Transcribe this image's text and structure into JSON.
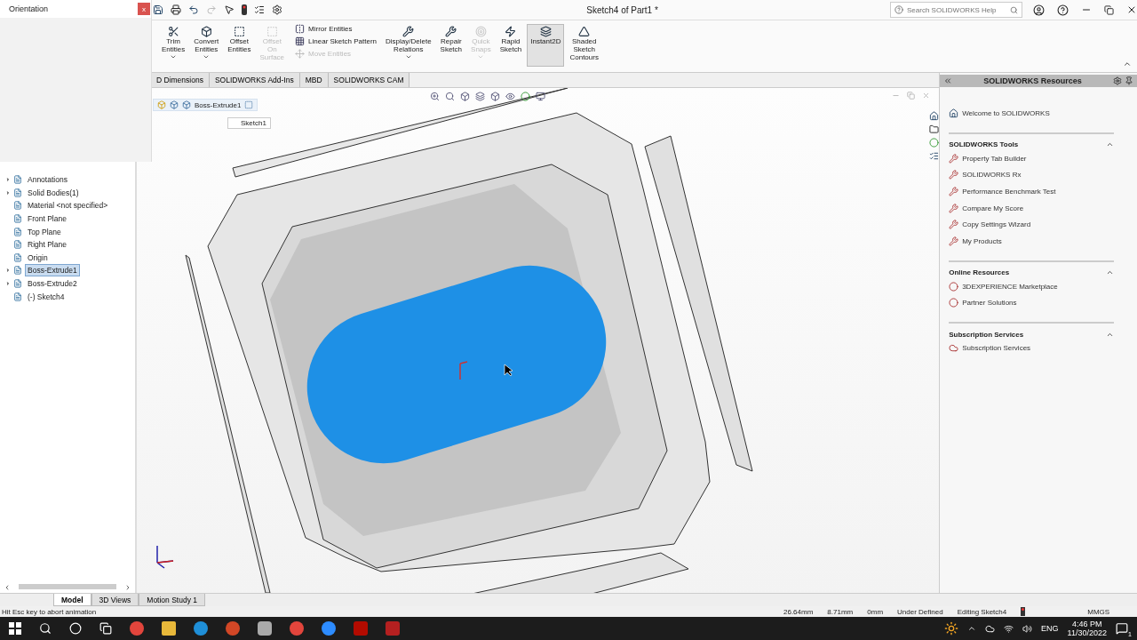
{
  "title_bar": {
    "title": "Sketch4 of Part1 *",
    "search": {
      "placeholder": "Search SOLIDWORKS Help"
    }
  },
  "orientation_popup": {
    "title": "Orientation",
    "close": "x"
  },
  "ribbon": {
    "commands": [
      {
        "kind": "big",
        "label": "Trim\nEntities",
        "disabled": false,
        "selected": false,
        "dropdown": true
      },
      {
        "kind": "big",
        "label": "Convert\nEntities",
        "disabled": false,
        "selected": false,
        "dropdown": true
      },
      {
        "kind": "big",
        "label": "Offset\nEntities",
        "disabled": false,
        "selected": false,
        "dropdown": false
      },
      {
        "kind": "big",
        "label": "Offset\nOn\nSurface",
        "disabled": true,
        "selected": false,
        "dropdown": false
      },
      {
        "kind": "stack",
        "items": [
          {
            "label": "Mirror Entities",
            "disabled": false
          },
          {
            "label": "Linear Sketch Pattern",
            "disabled": false
          },
          {
            "label": "Move Entities",
            "disabled": true
          }
        ]
      },
      {
        "kind": "big",
        "label": "Display/Delete\nRelations",
        "disabled": false,
        "selected": false,
        "dropdown": true
      },
      {
        "kind": "big",
        "label": "Repair\nSketch",
        "disabled": false,
        "selected": false,
        "dropdown": false
      },
      {
        "kind": "big",
        "label": "Quick\nSnaps",
        "disabled": true,
        "selected": false,
        "dropdown": true
      },
      {
        "kind": "big",
        "label": "Rapid\nSketch",
        "disabled": false,
        "selected": false,
        "dropdown": false
      },
      {
        "kind": "big",
        "label": "Instant2D",
        "disabled": false,
        "selected": true,
        "dropdown": false
      },
      {
        "kind": "big",
        "label": "Shaded\nSketch\nContours",
        "disabled": false,
        "selected": false,
        "dropdown": false
      }
    ]
  },
  "command_tabs": [
    "D Dimensions",
    "SOLIDWORKS Add-Ins",
    "MBD",
    "SOLIDWORKS CAM"
  ],
  "breadcrumb": {
    "feature": "Boss-Extrude1",
    "sketch": "Sketch1"
  },
  "feature_tree": [
    {
      "label": "Annotations",
      "expandable": true,
      "selected": false
    },
    {
      "label": "Solid Bodies(1)",
      "expandable": true,
      "selected": false
    },
    {
      "label": "Material <not specified>",
      "expandable": false,
      "selected": false
    },
    {
      "label": "Front Plane",
      "expandable": false,
      "selected": false
    },
    {
      "label": "Top Plane",
      "expandable": false,
      "selected": false
    },
    {
      "label": "Right Plane",
      "expandable": false,
      "selected": false
    },
    {
      "label": "Origin",
      "expandable": false,
      "selected": false
    },
    {
      "label": "Boss-Extrude1",
      "expandable": true,
      "selected": true
    },
    {
      "label": "Boss-Extrude2",
      "expandable": true,
      "selected": false
    },
    {
      "label": "(-) Sketch4",
      "expandable": false,
      "selected": false
    }
  ],
  "resources_panel": {
    "title": "SOLIDWORKS Resources",
    "welcome": "Welcome to SOLIDWORKS",
    "sections": [
      {
        "title": "SOLIDWORKS Tools",
        "expanded": true,
        "items": [
          "Property Tab Builder",
          "SOLIDWORKS Rx",
          "Performance Benchmark Test",
          "Compare My Score",
          "Copy Settings Wizard",
          "My Products"
        ]
      },
      {
        "title": "Online Resources",
        "expanded": true,
        "items": [
          "3DEXPERIENCE Marketplace",
          "Partner Solutions"
        ]
      },
      {
        "title": "Subscription Services",
        "expanded": true,
        "items": [
          "Subscription Services"
        ]
      }
    ]
  },
  "bottom_tabs": [
    {
      "label": "Model",
      "selected": true
    },
    {
      "label": "3D Views",
      "selected": false
    },
    {
      "label": "Motion Study 1",
      "selected": false
    }
  ],
  "status_bar": {
    "message": "Hit Esc key to abort animation",
    "readings": [
      "26.64mm",
      "8.71mm",
      "0mm",
      "Under Defined",
      "Editing Sketch4"
    ],
    "units": "MMGS"
  },
  "taskbar": {
    "language": "ENG",
    "time": "4:46 PM",
    "date": "11/30/2022",
    "notifications": "1"
  }
}
